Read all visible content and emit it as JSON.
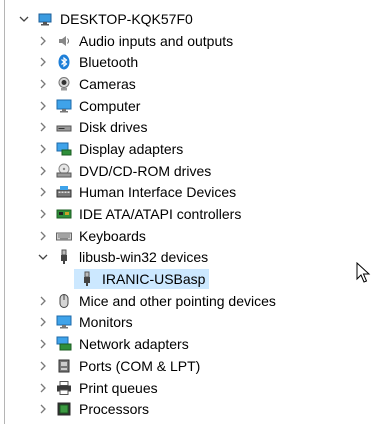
{
  "tree": {
    "root": {
      "label": "DESKTOP-KQK57F0",
      "expanded": true,
      "icon": "computer-root-icon"
    },
    "items": [
      {
        "label": "Audio inputs and outputs",
        "icon": "speaker-icon",
        "expanded": false
      },
      {
        "label": "Bluetooth",
        "icon": "bluetooth-icon",
        "expanded": false
      },
      {
        "label": "Cameras",
        "icon": "camera-icon",
        "expanded": false
      },
      {
        "label": "Computer",
        "icon": "monitor-icon",
        "expanded": false
      },
      {
        "label": "Disk drives",
        "icon": "disk-drive-icon",
        "expanded": false
      },
      {
        "label": "Display adapters",
        "icon": "display-adapter-icon",
        "expanded": false
      },
      {
        "label": "DVD/CD-ROM drives",
        "icon": "dvd-drive-icon",
        "expanded": false
      },
      {
        "label": "Human Interface Devices",
        "icon": "hid-icon",
        "expanded": false
      },
      {
        "label": "IDE ATA/ATAPI controllers",
        "icon": "ide-controller-icon",
        "expanded": false
      },
      {
        "label": "Keyboards",
        "icon": "keyboard-icon",
        "expanded": false
      },
      {
        "label": "libusb-win32 devices",
        "icon": "usb-plug-icon",
        "expanded": true,
        "children": [
          {
            "label": "IRANIC-USBasp",
            "icon": "usb-plug-icon",
            "selected": true
          }
        ]
      },
      {
        "label": "Mice and other pointing devices",
        "icon": "mouse-icon",
        "expanded": false
      },
      {
        "label": "Monitors",
        "icon": "monitor-icon",
        "expanded": false
      },
      {
        "label": "Network adapters",
        "icon": "network-icon",
        "expanded": false
      },
      {
        "label": "Ports (COM & LPT)",
        "icon": "port-icon",
        "expanded": false
      },
      {
        "label": "Print queues",
        "icon": "printer-icon",
        "expanded": false
      },
      {
        "label": "Processors",
        "icon": "processor-icon",
        "expanded": false
      }
    ]
  },
  "colors": {
    "selection": "#cce8ff",
    "chevron": "#7a7a7a",
    "accent_blue": "#1e7fd8"
  }
}
